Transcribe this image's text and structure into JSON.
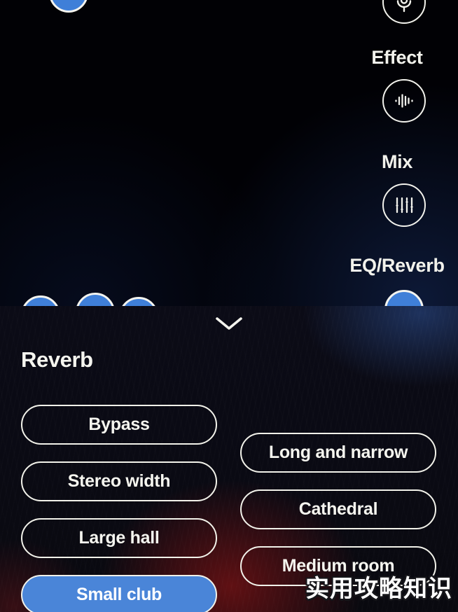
{
  "app": {
    "background_color": "#010105",
    "accent_color": "#4a85d8"
  },
  "rail": {
    "items": [
      {
        "label": "",
        "icon": "microphone-icon",
        "name": "mic-button"
      },
      {
        "label": "Effect",
        "icon": "waveform-icon",
        "name": "effect-button"
      },
      {
        "label": "Mix",
        "icon": "sliders-icon",
        "name": "mix-button"
      },
      {
        "label": "EQ/Reverb",
        "icon": "eq-reverb-icon",
        "name": "eq-reverb-button"
      }
    ],
    "effect_label": "Effect",
    "mix_label": "Mix",
    "eq_reverb_label": "EQ/Reverb"
  },
  "sheet": {
    "title": "Reverb",
    "collapse_icon": "chevron-down-icon",
    "presets": {
      "left_column": [
        {
          "label": "Bypass",
          "selected": false
        },
        {
          "label": "Stereo width",
          "selected": false
        },
        {
          "label": "Large hall",
          "selected": false
        },
        {
          "label": "Small club",
          "selected": true
        }
      ],
      "right_column": [
        {
          "label": "Long and narrow",
          "selected": false
        },
        {
          "label": "Cathedral",
          "selected": false
        },
        {
          "label": "Medium room",
          "selected": false
        }
      ]
    }
  },
  "watermark": {
    "text": "实用攻略知识"
  }
}
